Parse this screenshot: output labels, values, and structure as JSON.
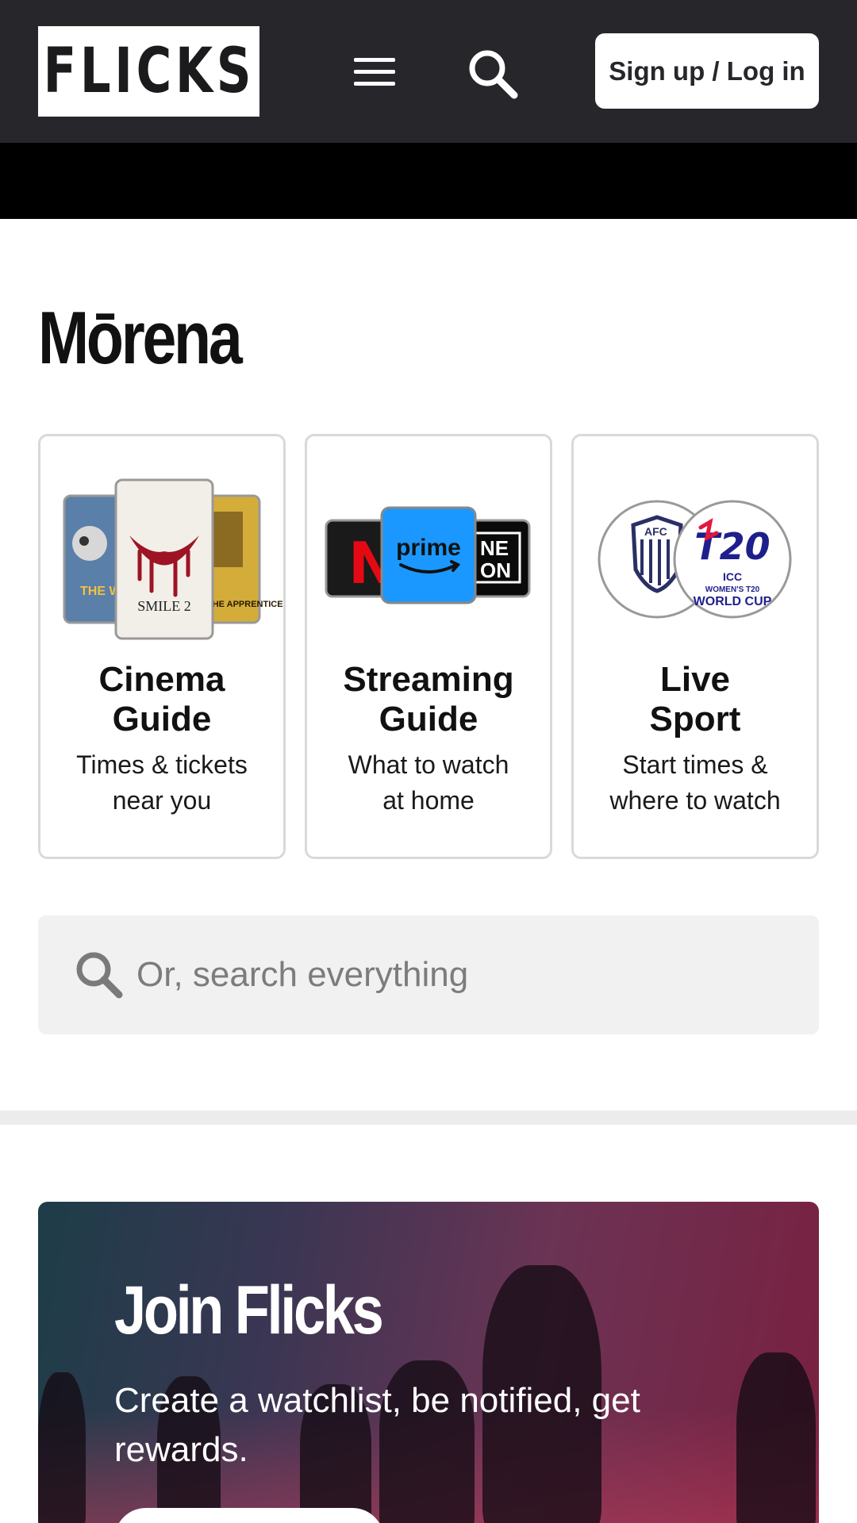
{
  "header": {
    "logo_text": "FLICKS",
    "menu_icon": "hamburger-menu-icon",
    "search_icon": "search-icon",
    "signup_label": "Sign up / Log in"
  },
  "greeting": "Mōrena",
  "cards": [
    {
      "title_line1": "Cinema",
      "title_line2": "Guide",
      "subtitle_line1": "Times & tickets",
      "subtitle_line2": "near you",
      "art_text": [
        "SMILE 2",
        "THE WILD ROBOT",
        "THE APPRENTICE"
      ]
    },
    {
      "title_line1": "Streaming",
      "title_line2": "Guide",
      "subtitle_line1": "What to watch",
      "subtitle_line2": "at home",
      "art_text": [
        "N",
        "prime",
        "NE",
        "ON"
      ]
    },
    {
      "title_line1": "Live",
      "title_line2": "Sport",
      "subtitle_line1": "Start times &",
      "subtitle_line2": "where to watch",
      "art_text": [
        "AFC",
        "T20",
        "ICC",
        "WOMEN'S T20",
        "WORLD CUP"
      ]
    }
  ],
  "search": {
    "placeholder": "Or, search everything"
  },
  "promo": {
    "title": "Join Flicks",
    "subtitle": "Create a watchlist, be notified, get rewards."
  },
  "colors": {
    "header_bg": "#27262b",
    "prime_blue": "#1a98ff",
    "netflix_red": "#e50914",
    "t20_blue": "#1e1f8c",
    "t20_red": "#e4173c"
  }
}
